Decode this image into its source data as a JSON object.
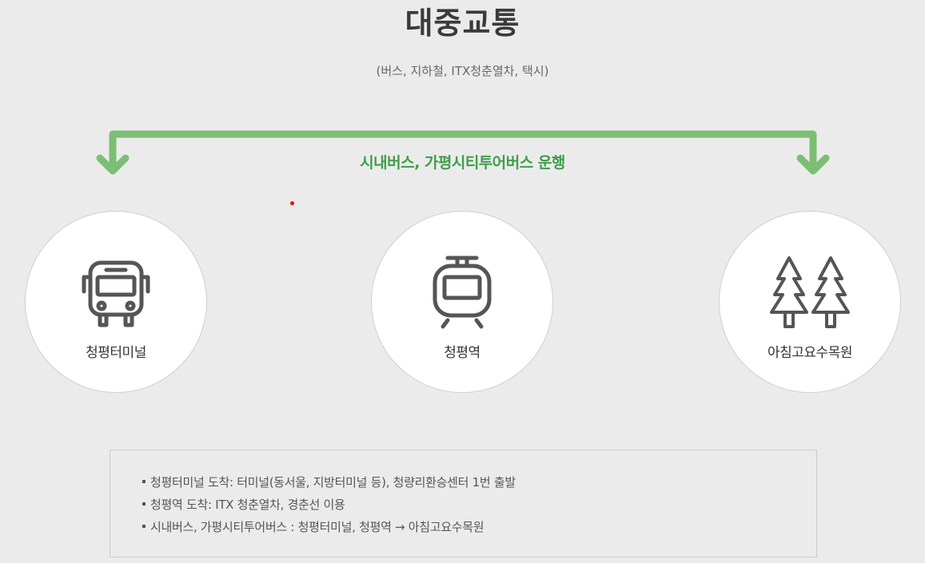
{
  "header": {
    "title": "대중교통",
    "subtitle": "(버스, 지하철, ITX청춘열차, 택시)"
  },
  "route": {
    "label": "시내버스, 가평시티투어버스 운행",
    "color": "#7bbf74"
  },
  "stops": [
    {
      "icon": "bus-icon",
      "label": "청평터미널"
    },
    {
      "icon": "tram-icon",
      "label": "청평역"
    },
    {
      "icon": "trees-icon",
      "label": "아침고요수목원"
    }
  ],
  "info": {
    "items": [
      "청평터미널 도착: 터미널(동서울, 지방터미널 등), 청량리환승센터 1번 출발",
      "청평역 도착: ITX 청춘열차, 경춘선 이용",
      "시내버스, 가평시티투어버스 : 청평터미널, 청평역 → 아침고요수목원"
    ]
  }
}
